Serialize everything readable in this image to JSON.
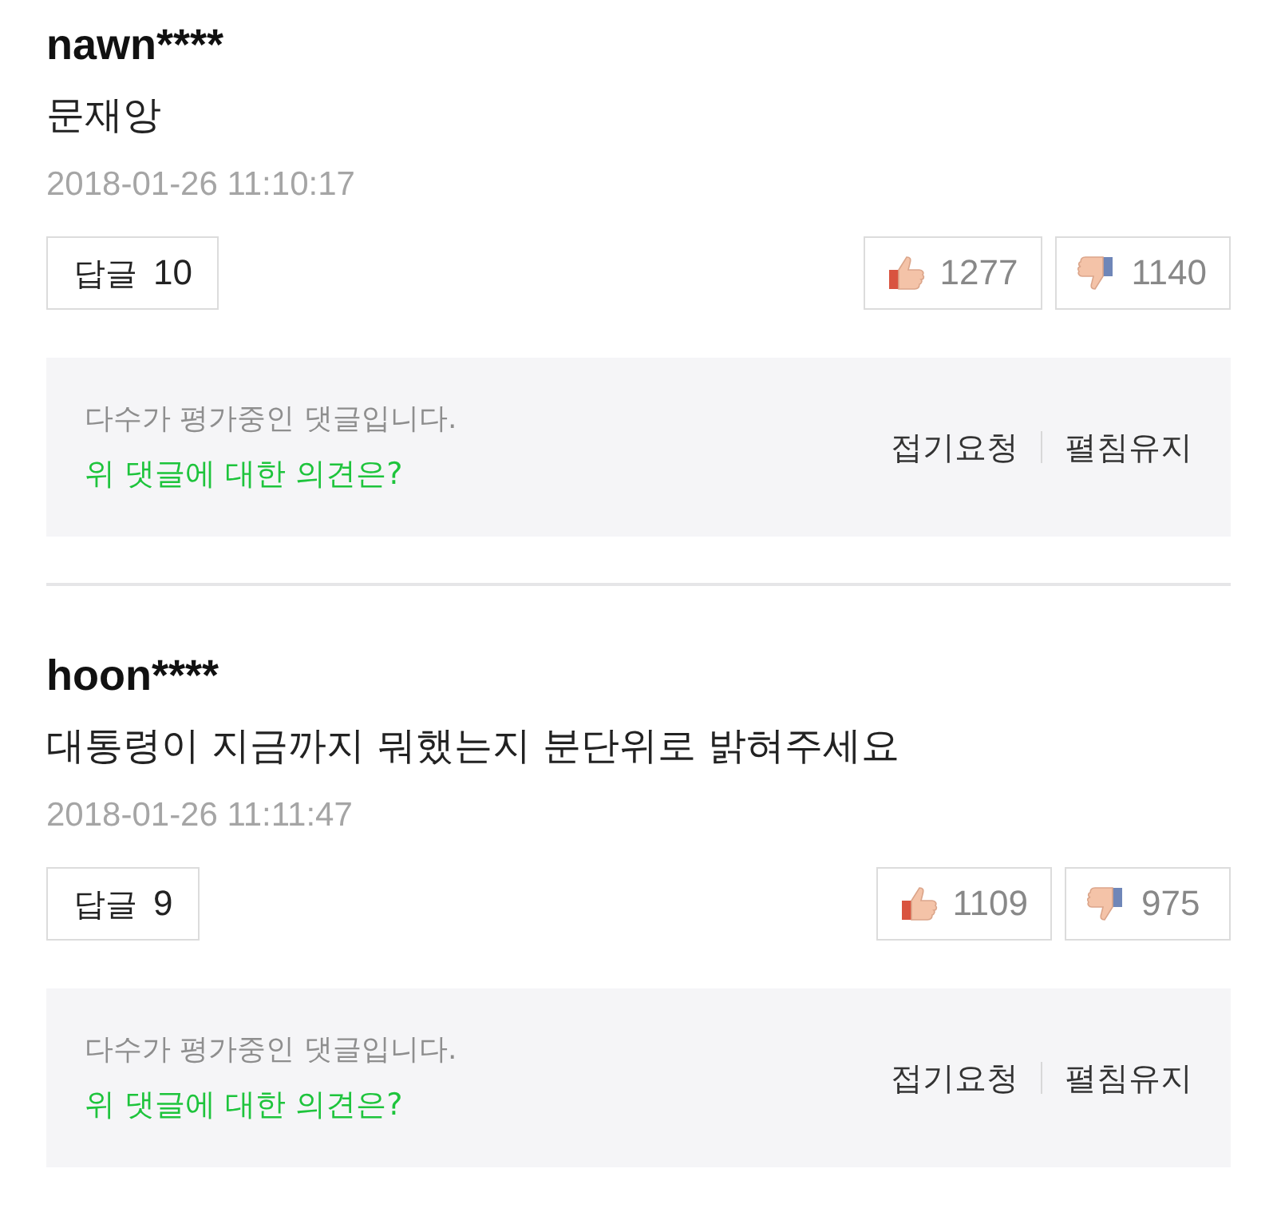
{
  "comments": [
    {
      "user": "nawn****",
      "text": "문재앙",
      "date": "2018-01-26 11:10:17",
      "reply_label": "답글",
      "reply_count": "10",
      "likes": "1277",
      "dislikes": "1140",
      "notice": "다수가 평가중인 댓글입니다.",
      "question": "위 댓글에 대한 의견은?",
      "actions": [
        "접기요청",
        "펼침유지"
      ]
    },
    {
      "user": "hoon****",
      "text": "대통령이 지금까지 뭐했는지 분단위로 밝혀주세요",
      "date": "2018-01-26 11:11:47",
      "reply_label": "답글",
      "reply_count": "9",
      "likes": "1109",
      "dislikes": "975",
      "notice": "다수가 평가중인 댓글입니다.",
      "question": "위 댓글에 대한 의견은?",
      "actions": [
        "접기요청",
        "펼침유지"
      ]
    }
  ]
}
